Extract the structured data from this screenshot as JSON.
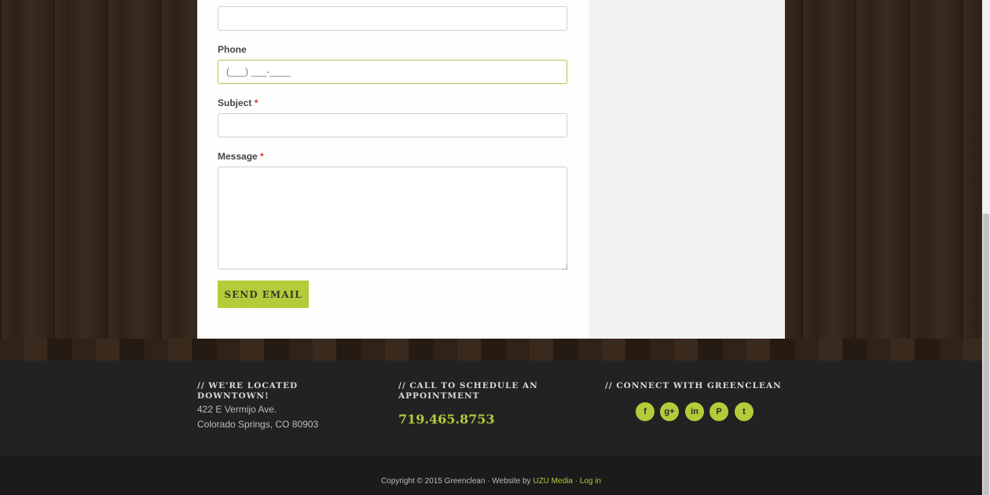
{
  "form": {
    "phone_label": "Phone",
    "phone_placeholder": "(___) ___-____",
    "subject_label": "Subject",
    "message_label": "Message",
    "required_mark": "*",
    "send_label": "SEND EMAIL"
  },
  "footer": {
    "location_heading": "//  WE'RE LOCATED DOWNTOWN!",
    "address_line1": "422 E Vermijo Ave.",
    "address_line2": "Colorado Springs, CO 80903",
    "call_heading": "//  CALL TO SCHEDULE AN APPOINTMENT",
    "phone": "719.465.8753",
    "connect_heading": "//  CONNECT WITH GREENCLEAN",
    "social": [
      {
        "icon": "facebook-icon",
        "glyph": "f"
      },
      {
        "icon": "google-plus-icon",
        "glyph": "g+"
      },
      {
        "icon": "linkedin-icon",
        "glyph": "in"
      },
      {
        "icon": "pinterest-icon",
        "glyph": "P"
      },
      {
        "icon": "twitter-icon",
        "glyph": "t"
      }
    ],
    "copyright_text": "Copyright © 2015 Greenclean · Website by ",
    "agency_link": "UZU Media",
    "separator": " · ",
    "login_link": "Log in"
  },
  "colors": {
    "accent": "#b4cb3a",
    "required": "#e0362b",
    "footer_bg": "#222222"
  }
}
